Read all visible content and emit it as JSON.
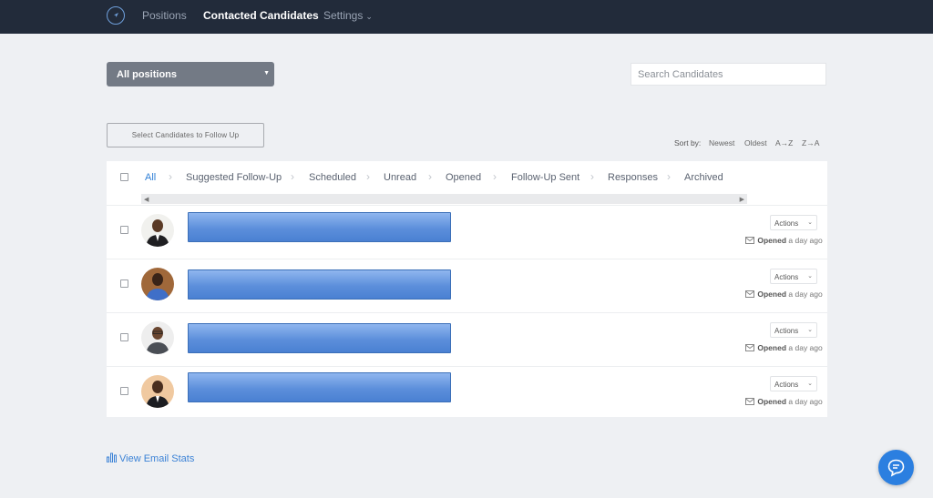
{
  "nav": {
    "items": [
      {
        "label": "Positions"
      },
      {
        "label": "Contacted Candidates"
      },
      {
        "label": "Settings"
      }
    ]
  },
  "filters": {
    "position_select": "All positions",
    "search_placeholder": "Search Candidates"
  },
  "toolbar": {
    "follow_up_button": "Select Candidates to Follow Up",
    "sort_label": "Sort by:",
    "sort_options": [
      "Newest",
      "Oldest",
      "A→Z",
      "Z→A"
    ]
  },
  "tabs": [
    {
      "label": "All",
      "active": true
    },
    {
      "label": "Suggested Follow-Up"
    },
    {
      "label": "Scheduled"
    },
    {
      "label": "Unread"
    },
    {
      "label": "Opened"
    },
    {
      "label": "Follow-Up Sent"
    },
    {
      "label": "Responses"
    },
    {
      "label": "Archived"
    }
  ],
  "candidates": [
    {
      "actions_label": "Actions",
      "status_label": "Opened",
      "status_time": "a day ago"
    },
    {
      "actions_label": "Actions",
      "status_label": "Opened",
      "status_time": "a day ago"
    },
    {
      "actions_label": "Actions",
      "status_label": "Opened",
      "status_time": "a day ago"
    },
    {
      "actions_label": "Actions",
      "status_label": "Opened",
      "status_time": "a day ago"
    }
  ],
  "footer": {
    "email_stats_link": "View Email Stats"
  },
  "icons": {
    "logo": "compass-icon",
    "status": "envelope-icon",
    "stats": "bar-chart-icon",
    "chat": "chat-bubble-icon"
  },
  "colors": {
    "nav_bg": "#222b3a",
    "accent": "#2f7fd6",
    "redaction_fill": "#5c8fdb",
    "chat_button": "#2b7fe0"
  }
}
